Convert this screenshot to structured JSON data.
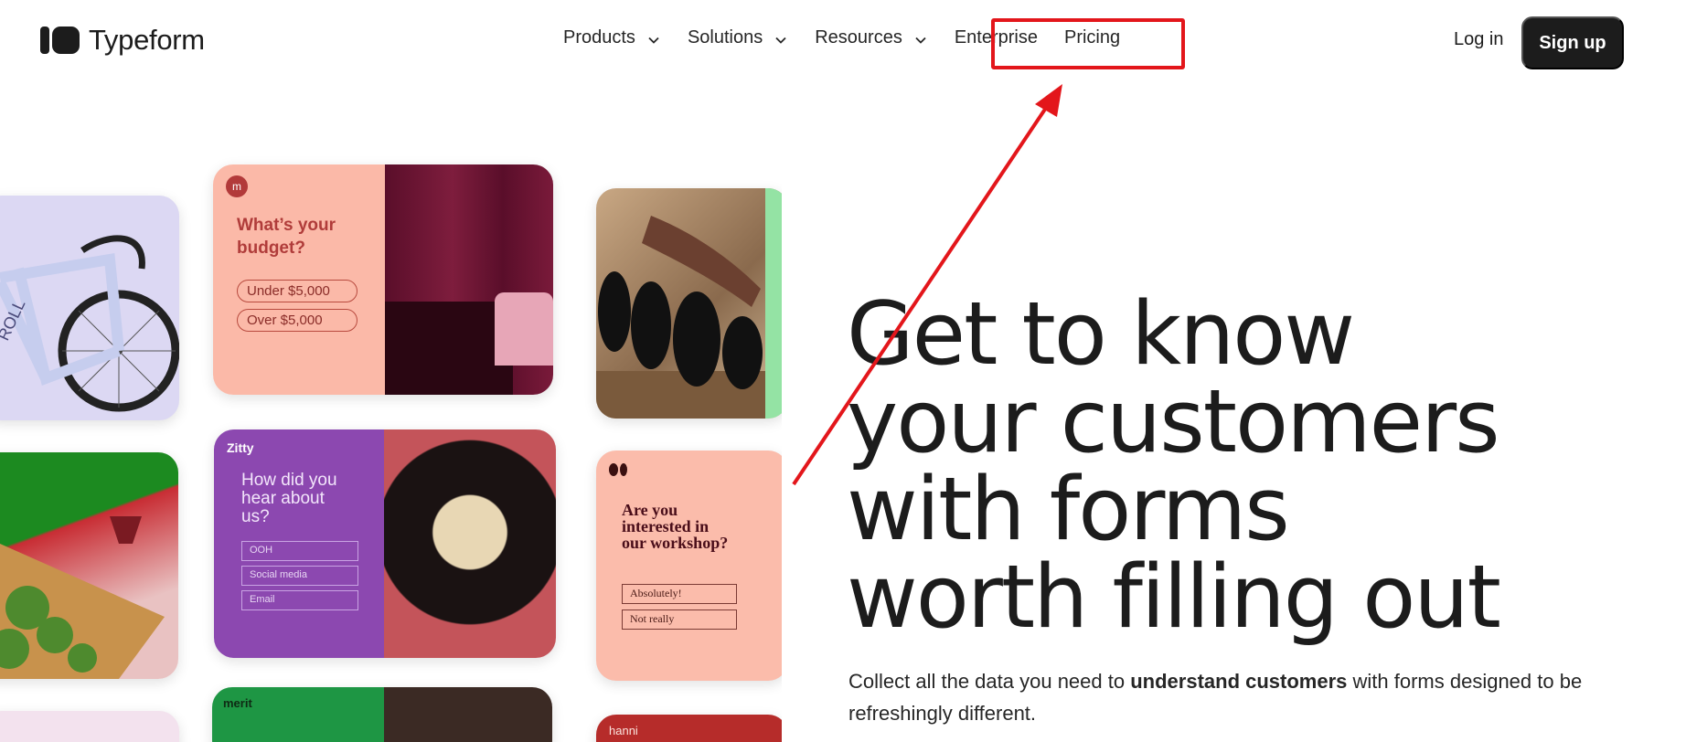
{
  "header": {
    "logo_text": "Typeform",
    "nav": [
      {
        "label": "Products",
        "has_dropdown": true
      },
      {
        "label": "Solutions",
        "has_dropdown": true
      },
      {
        "label": "Resources",
        "has_dropdown": true
      },
      {
        "label": "Enterprise",
        "has_dropdown": false
      },
      {
        "label": "Pricing",
        "has_dropdown": false
      }
    ],
    "login_label": "Log in",
    "signup_label": "Sign up"
  },
  "gallery": {
    "budget_card": {
      "question": "What’s your budget?",
      "options": [
        "Under $5,000",
        "Over $5,000"
      ]
    },
    "zitty_card": {
      "brand": "Zitty",
      "question": "How did you hear about us?",
      "options": [
        "OOH",
        "Social media",
        "Email"
      ]
    },
    "workshop_card": {
      "question": "Are you interested in our workshop?",
      "options": [
        "Absolutely!",
        "Not really"
      ]
    },
    "merit_card": {
      "brand": "merit"
    },
    "hanni_card": {
      "brand": "hanni"
    }
  },
  "hero": {
    "title_lines": [
      "Get to know",
      "your customers",
      "with forms",
      "worth filling out"
    ],
    "subtitle_pre": "Collect all the data you need to ",
    "subtitle_bold": "understand customers",
    "subtitle_post": " with forms designed to be refreshingly different."
  },
  "annotation": {
    "color": "#e3161b",
    "target": "Pricing"
  }
}
